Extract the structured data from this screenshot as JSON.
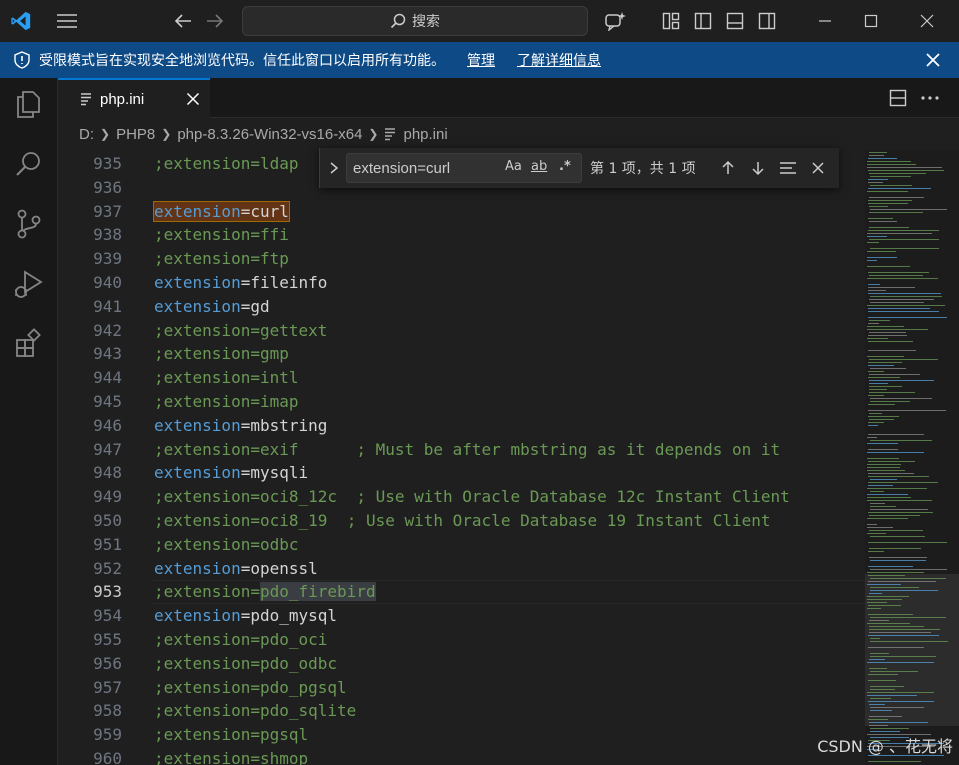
{
  "titlebar": {
    "search_label": "搜索"
  },
  "banner": {
    "message": "受限模式旨在实现安全地浏览代码。信任此窗口以启用所有功能。",
    "manage_label": "管理",
    "learn_more_label": "了解详细信息"
  },
  "tab": {
    "label": "php.ini"
  },
  "breadcrumb": {
    "items": [
      "D:",
      "PHP8",
      "php-8.3.26-Win32-vs16-x64",
      "php.ini"
    ]
  },
  "find": {
    "query": "extension=curl",
    "match_case_label": "Aa",
    "whole_word_label": "ab",
    "regex_label": ".*",
    "count_text": "第 1 项，共 1 项"
  },
  "editor": {
    "active_line": 953,
    "lines": [
      {
        "n": "935",
        "prefix": ";",
        "key": "extension",
        "value": "ldap",
        "comment": ""
      },
      {
        "n": "936",
        "prefix": "",
        "key": "",
        "value": "",
        "comment": ""
      },
      {
        "n": "937",
        "prefix": "",
        "key": "extension",
        "value": "curl",
        "comment": ""
      },
      {
        "n": "938",
        "prefix": ";",
        "key": "extension",
        "value": "ffi",
        "comment": ""
      },
      {
        "n": "939",
        "prefix": ";",
        "key": "extension",
        "value": "ftp",
        "comment": ""
      },
      {
        "n": "940",
        "prefix": "",
        "key": "extension",
        "value": "fileinfo",
        "comment": ""
      },
      {
        "n": "941",
        "prefix": "",
        "key": "extension",
        "value": "gd",
        "comment": ""
      },
      {
        "n": "942",
        "prefix": ";",
        "key": "extension",
        "value": "gettext",
        "comment": ""
      },
      {
        "n": "943",
        "prefix": ";",
        "key": "extension",
        "value": "gmp",
        "comment": ""
      },
      {
        "n": "944",
        "prefix": ";",
        "key": "extension",
        "value": "intl",
        "comment": ""
      },
      {
        "n": "945",
        "prefix": ";",
        "key": "extension",
        "value": "imap",
        "comment": ""
      },
      {
        "n": "946",
        "prefix": "",
        "key": "extension",
        "value": "mbstring",
        "comment": ""
      },
      {
        "n": "947",
        "prefix": ";",
        "key": "extension",
        "value": "exif",
        "comment": "      ; Must be after mbstring as it depends on it"
      },
      {
        "n": "948",
        "prefix": "",
        "key": "extension",
        "value": "mysqli",
        "comment": ""
      },
      {
        "n": "949",
        "prefix": ";",
        "key": "extension",
        "value": "oci8_12c",
        "comment": "  ; Use with Oracle Database 12c Instant Client"
      },
      {
        "n": "950",
        "prefix": ";",
        "key": "extension",
        "value": "oci8_19",
        "comment": "  ; Use with Oracle Database 19 Instant Client"
      },
      {
        "n": "951",
        "prefix": ";",
        "key": "extension",
        "value": "odbc",
        "comment": ""
      },
      {
        "n": "952",
        "prefix": "",
        "key": "extension",
        "value": "openssl",
        "comment": ""
      },
      {
        "n": "953",
        "prefix": ";",
        "key": "extension",
        "value": "pdo_firebird",
        "comment": ""
      },
      {
        "n": "954",
        "prefix": "",
        "key": "extension",
        "value": "pdo_mysql",
        "comment": ""
      },
      {
        "n": "955",
        "prefix": ";",
        "key": "extension",
        "value": "pdo_oci",
        "comment": ""
      },
      {
        "n": "956",
        "prefix": ";",
        "key": "extension",
        "value": "pdo_odbc",
        "comment": ""
      },
      {
        "n": "957",
        "prefix": ";",
        "key": "extension",
        "value": "pdo_pgsql",
        "comment": ""
      },
      {
        "n": "958",
        "prefix": ";",
        "key": "extension",
        "value": "pdo_sqlite",
        "comment": ""
      },
      {
        "n": "959",
        "prefix": ";",
        "key": "extension",
        "value": "pgsql",
        "comment": ""
      },
      {
        "n": "960",
        "prefix": ";",
        "key": "extension",
        "value": "shmop",
        "comment": ""
      }
    ]
  },
  "watermark": "CSDN @ 、花无将",
  "colors": {
    "accent": "#0078d4",
    "banner": "#0e4a86",
    "comment": "#6a9955",
    "keyword": "#569cd6",
    "match": "#623315"
  },
  "icons": [
    "vscode-logo-icon",
    "menu-icon",
    "back-arrow-icon",
    "forward-arrow-icon",
    "search-icon",
    "copilot-icon",
    "layout-customize-icon",
    "toggle-sidebar-icon",
    "toggle-panel-icon",
    "toggle-secondary-sidebar-icon",
    "minimize-icon",
    "maximize-icon",
    "close-window-icon",
    "shield-icon",
    "explorer-icon",
    "search-view-icon",
    "source-control-icon",
    "run-debug-icon",
    "extensions-icon",
    "file-icon",
    "split-editor-icon",
    "more-actions-icon"
  ]
}
